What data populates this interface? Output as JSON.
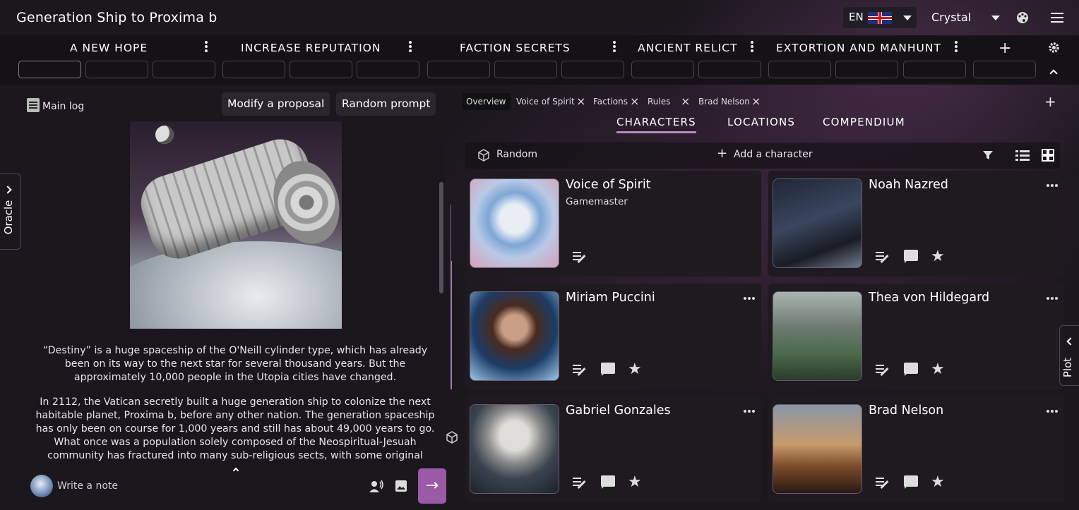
{
  "app": {
    "title": "Generation Ship to Proxima b"
  },
  "header": {
    "lang_code": "EN",
    "user_name": "Crystal"
  },
  "plots": [
    {
      "title": "A NEW HOPE"
    },
    {
      "title": "INCREASE REPUTATION"
    },
    {
      "title": "FACTION SECRETS"
    },
    {
      "title": "ANCIENT RELICT"
    },
    {
      "title": "EXTORTION AND MANHUNT"
    }
  ],
  "log": {
    "main_log_label": "Main log",
    "modify_label": "Modify a proposal",
    "random_prompt_label": "Random prompt",
    "paragraphs": [
      "“Destiny” is a huge spaceship of the O'Neill cylinder type, which has already been on its way to the next star for several thousand years. But the approximately 10,000 people in the Utopia cities have changed.",
      "In 2112, the Vatican secretly built a huge generation ship to colonize the next habitable planet, Proxima b, before any other nation. The generation spaceship has only been on course for 1,000 years and still has about 49,000 years to go. What once was a population solely composed of the Neospiritual-Jesuah community has fractured into many sub-religious sects, with some original"
    ],
    "note_placeholder": "Write a note",
    "oracle_label": "Oracle"
  },
  "side": {
    "plot_label": "Plot"
  },
  "open_tabs": [
    {
      "label": "Overview"
    },
    {
      "label": "Voice of Spirit"
    },
    {
      "label": "Factions"
    },
    {
      "label": "Rules"
    },
    {
      "label": "Brad Nelson"
    }
  ],
  "sections": {
    "characters": "CHARACTERS",
    "locations": "LOCATIONS",
    "compendium": "COMPENDIUM"
  },
  "toolbar": {
    "random_label": "Random",
    "add_label": "Add a character"
  },
  "characters": [
    {
      "name": "Voice of Spirit",
      "role": "Gamemaster"
    },
    {
      "name": "Noah Nazred",
      "role": ""
    },
    {
      "name": "Miriam Puccini",
      "role": ""
    },
    {
      "name": "Thea von Hildegard",
      "role": ""
    },
    {
      "name": "Gabriel Gonzales",
      "role": ""
    },
    {
      "name": "Brad Nelson",
      "role": ""
    }
  ],
  "colors": {
    "accent": "#b787c3",
    "send_button": "#9a5aa8",
    "background": "#1b171d"
  }
}
